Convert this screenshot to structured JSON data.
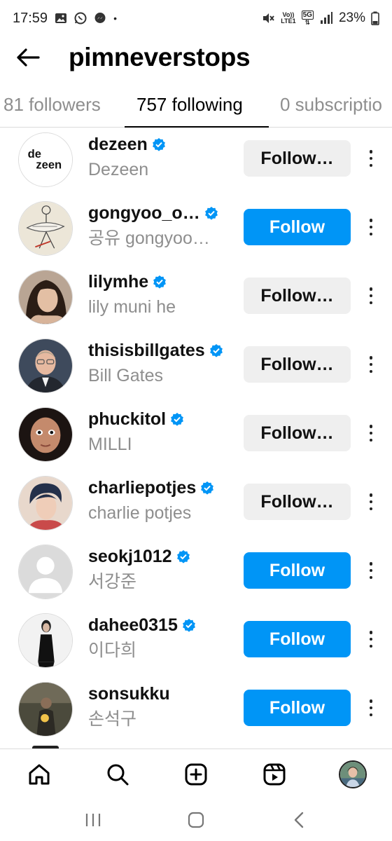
{
  "status_bar": {
    "time": "17:59",
    "dot": "•",
    "volte": "Vo))",
    "lte": "LTE1",
    "network": "5G",
    "battery": "23%"
  },
  "header": {
    "title": "pimneverstops"
  },
  "tabs": [
    {
      "label": "81 followers",
      "active": false
    },
    {
      "label": "757 following",
      "active": true
    },
    {
      "label": "0 subscriptio",
      "active": false
    }
  ],
  "list": [
    {
      "username": "dezeen",
      "full_name": "Dezeen",
      "verified": true,
      "button": "Follow…",
      "button_style": "following",
      "avatar_icon": "dezeen-logo-avatar",
      "avatar_text": "de\nzeen"
    },
    {
      "username": "gongyoo_o…",
      "full_name": "공유 gongyoo…",
      "verified": true,
      "button": "Follow",
      "button_style": "primary",
      "avatar_icon": "sketch-avatar"
    },
    {
      "username": "lilymhe",
      "full_name": "lily muni he",
      "verified": true,
      "button": "Follow…",
      "button_style": "following",
      "avatar_icon": "portrait-avatar"
    },
    {
      "username": "thisisbillgates",
      "full_name": "Bill Gates",
      "verified": true,
      "button": "Follow…",
      "button_style": "following",
      "avatar_icon": "portrait-avatar"
    },
    {
      "username": "phuckitol",
      "full_name": "MILLI",
      "verified": true,
      "button": "Follow…",
      "button_style": "following",
      "avatar_icon": "portrait-avatar"
    },
    {
      "username": "charliepotjes",
      "full_name": "charlie potjes",
      "verified": true,
      "button": "Follow…",
      "button_style": "following",
      "avatar_icon": "portrait-avatar"
    },
    {
      "username": "seokj1012",
      "full_name": "서강준",
      "verified": true,
      "button": "Follow",
      "button_style": "primary",
      "avatar_icon": "default-avatar"
    },
    {
      "username": "dahee0315",
      "full_name": "이다희",
      "verified": true,
      "button": "Follow",
      "button_style": "primary",
      "avatar_icon": "portrait-avatar"
    },
    {
      "username": "sonsukku",
      "full_name": "손석구",
      "verified": false,
      "button": "Follow",
      "button_style": "primary",
      "avatar_icon": "portrait-avatar"
    }
  ],
  "bottom_nav": [
    "home-icon",
    "search-icon",
    "create-icon",
    "reels-icon",
    "profile-avatar"
  ],
  "system_nav": [
    "recents-icon",
    "home-circle-icon",
    "back-chevron-icon"
  ],
  "colors": {
    "primary_button": "#0095f6",
    "secondary_button": "#efefef",
    "verified_badge": "#0095f6",
    "muted_text": "#8e8e8e"
  }
}
